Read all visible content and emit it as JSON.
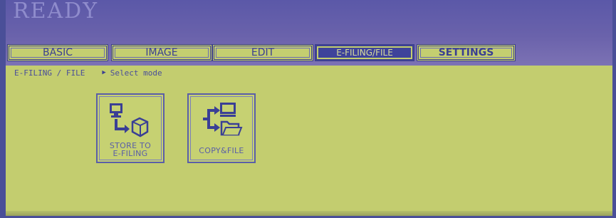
{
  "status": {
    "text": "READY"
  },
  "tabs": [
    {
      "label": "BASIC",
      "active": false
    },
    {
      "label": "IMAGE",
      "active": false
    },
    {
      "label": "EDIT",
      "active": false
    },
    {
      "label": "E-FILING/FILE",
      "active": true
    },
    {
      "label": "SETTINGS",
      "active": false
    }
  ],
  "breadcrumb": {
    "path": "E-FILING / FILE",
    "hint": "Select mode"
  },
  "functions": [
    {
      "label_line1": "STORE TO",
      "label_line2": "E-FILING",
      "icon": "store-to-efiling-icon"
    },
    {
      "label_line1": "COPY&FILE",
      "icon": "copy-and-file-icon"
    }
  ],
  "colors": {
    "screen": "#c3cd6f",
    "top_band": "#5b58a8",
    "tab_border": "#3c3f8c",
    "active_tab": "#3e439a",
    "text": "#4a4e9a"
  }
}
